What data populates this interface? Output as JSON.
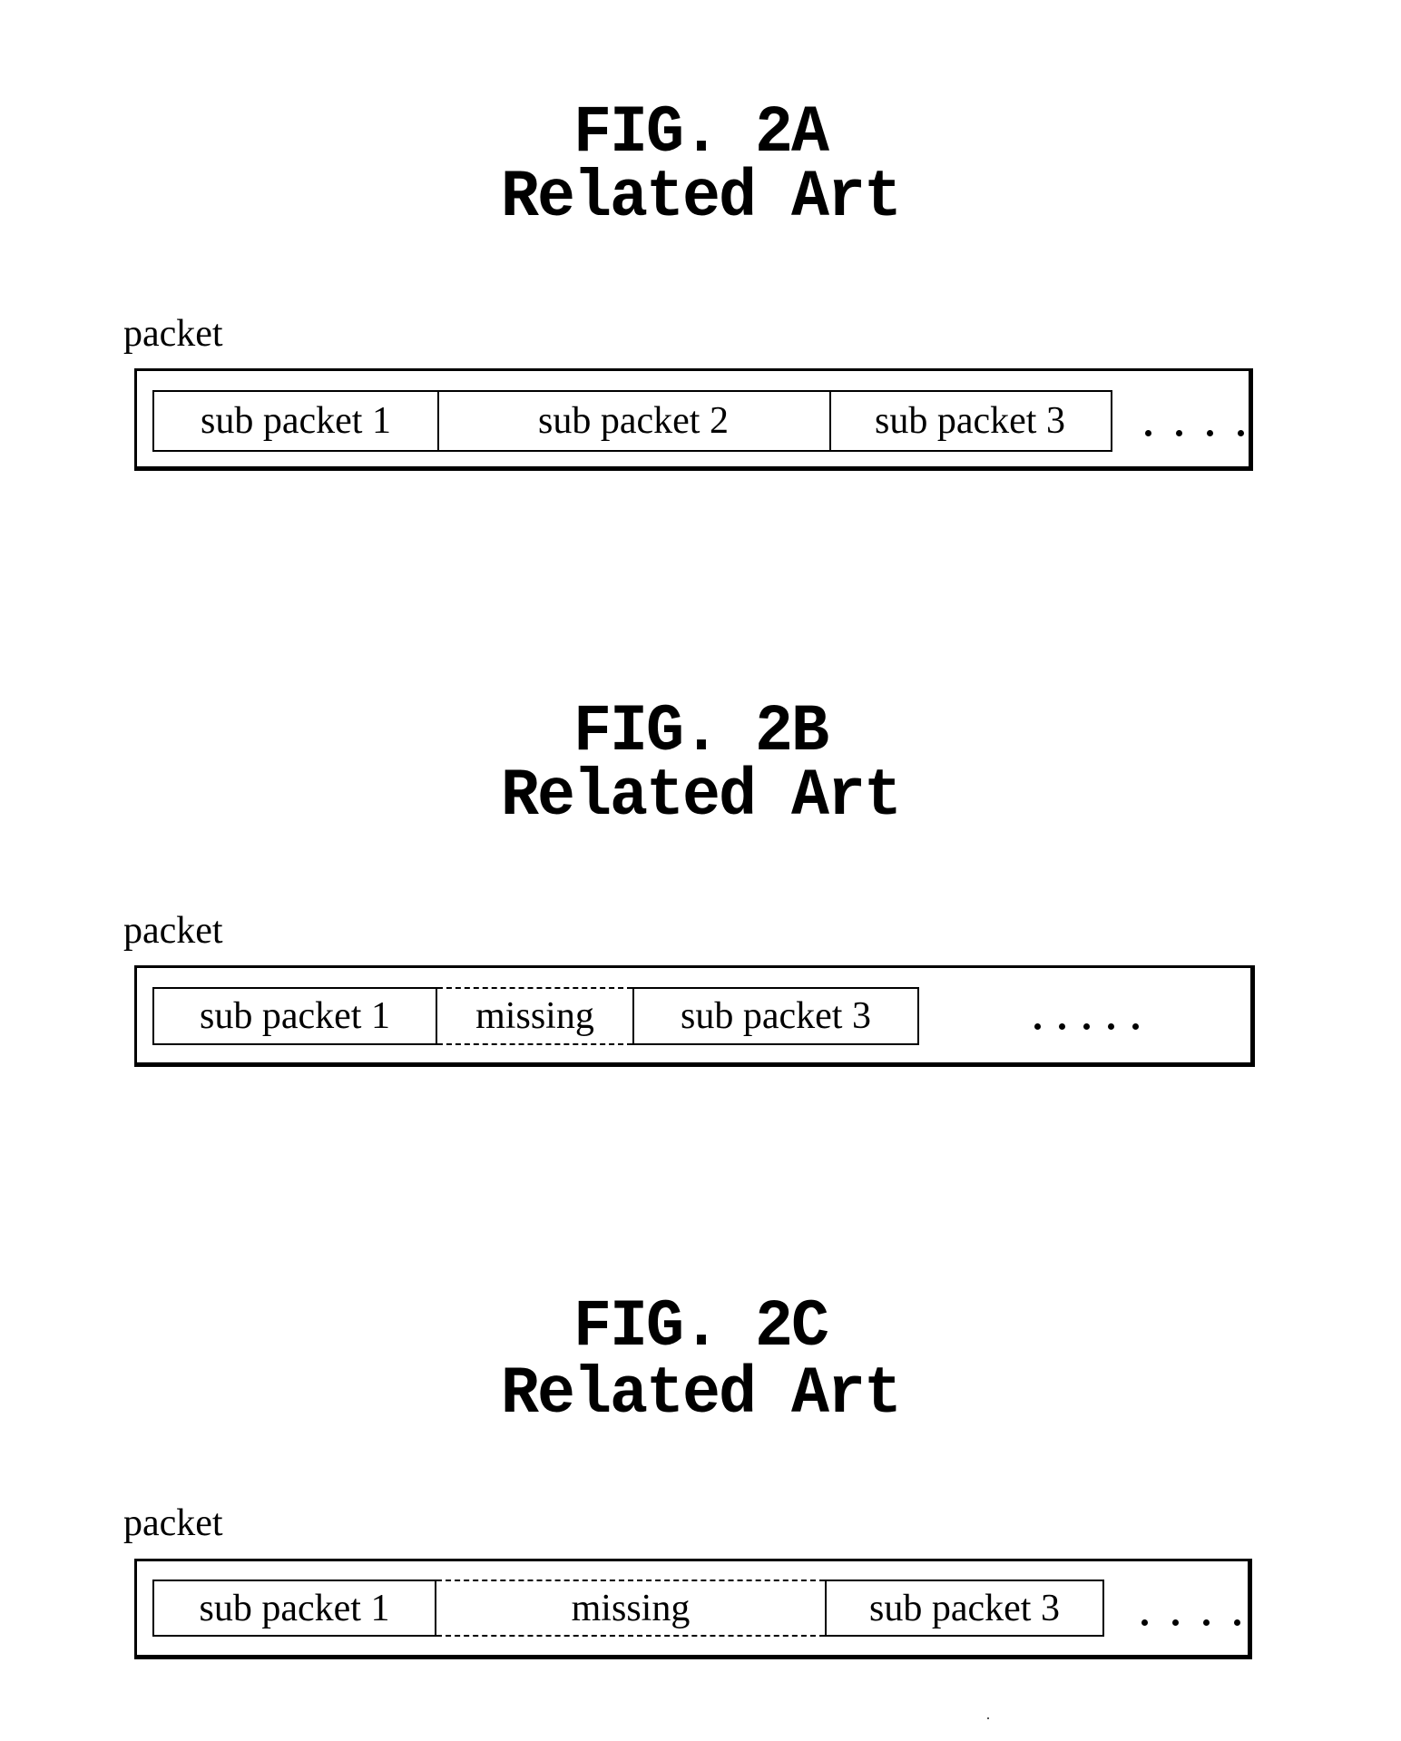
{
  "figures": [
    {
      "id": "2A",
      "fig_label": "FIG. 2A",
      "subtitle": "Related Art",
      "packet_label": "packet",
      "cells": [
        {
          "text": "sub packet 1",
          "style": "solid"
        },
        {
          "text": "sub packet 2",
          "style": "solid"
        },
        {
          "text": "sub packet 3",
          "style": "solid"
        }
      ],
      "ellipsis_dots": 4
    },
    {
      "id": "2B",
      "fig_label": "FIG. 2B",
      "subtitle": "Related Art",
      "packet_label": "packet",
      "cells": [
        {
          "text": "sub packet 1",
          "style": "solid"
        },
        {
          "text": "missing",
          "style": "dashed"
        },
        {
          "text": "sub packet 3",
          "style": "solid"
        }
      ],
      "ellipsis_dots": 5
    },
    {
      "id": "2C",
      "fig_label": "FIG. 2C",
      "subtitle": "Related Art",
      "packet_label": "packet",
      "cells": [
        {
          "text": "sub packet 1",
          "style": "solid"
        },
        {
          "text": "missing",
          "style": "dashed"
        },
        {
          "text": "sub packet 3",
          "style": "solid"
        }
      ],
      "ellipsis_dots": 4
    }
  ]
}
